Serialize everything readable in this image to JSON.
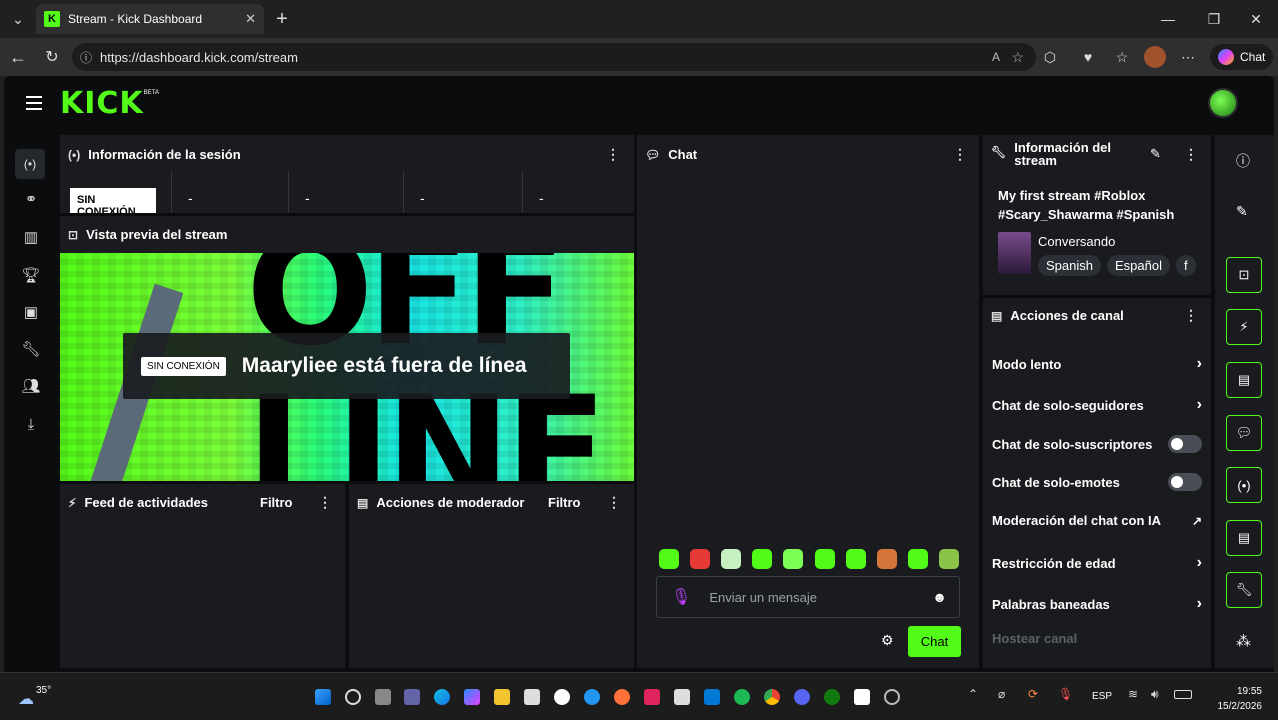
{
  "browser": {
    "tab_title": "Stream - Kick Dashboard",
    "url": "https://dashboard.kick.com/stream",
    "copilot_label": "Chat"
  },
  "app": {
    "logo": "KICK",
    "logo_badge": "BETA"
  },
  "session": {
    "title": "Información de la sesión",
    "status_badge": "SIN CONEXIÓN",
    "stats": [
      "-",
      "-",
      "-",
      "-"
    ]
  },
  "preview": {
    "title": "Vista previa del stream",
    "offline_badge": "SIN CONEXIÓN",
    "offline_message": "Maaryliee está fuera de línea",
    "bg_text_top": "OFF",
    "bg_text_bottom": "LINE"
  },
  "activity": {
    "title": "Feed de actividades",
    "filter": "Filtro"
  },
  "mod_actions": {
    "title": "Acciones de moderador",
    "filter": "Filtro"
  },
  "chat": {
    "title": "Chat",
    "placeholder": "Enviar un mensaje",
    "send_label": "Chat",
    "emote_count": 10
  },
  "stream_info": {
    "title": "Información del stream",
    "stream_title": "My first stream #Roblox #Scary_Shawarma #Spanish",
    "category": "Conversando",
    "tags": [
      "Spanish",
      "Español",
      "f"
    ]
  },
  "channel_actions": {
    "title": "Acciones de canal",
    "items": [
      {
        "label": "Modo lento",
        "control": "chevron"
      },
      {
        "label": "Chat de solo-seguidores",
        "control": "chevron"
      },
      {
        "label": "Chat de solo-suscriptores",
        "control": "toggle"
      },
      {
        "label": "Chat de solo-emotes",
        "control": "toggle"
      },
      {
        "label": "Moderación del chat con IA",
        "control": "external"
      },
      {
        "label": "Restricción de edad",
        "control": "chevron"
      },
      {
        "label": "Palabras baneadas",
        "control": "chevron"
      },
      {
        "label": "Hostear canal",
        "control": "none"
      }
    ]
  },
  "taskbar": {
    "temperature": "35°",
    "language": "ESP",
    "time": "19:55",
    "date": "15/2/2026"
  },
  "colors": {
    "accent": "#53fc18",
    "panel": "#191b1f",
    "bg": "#0b0c0e"
  }
}
